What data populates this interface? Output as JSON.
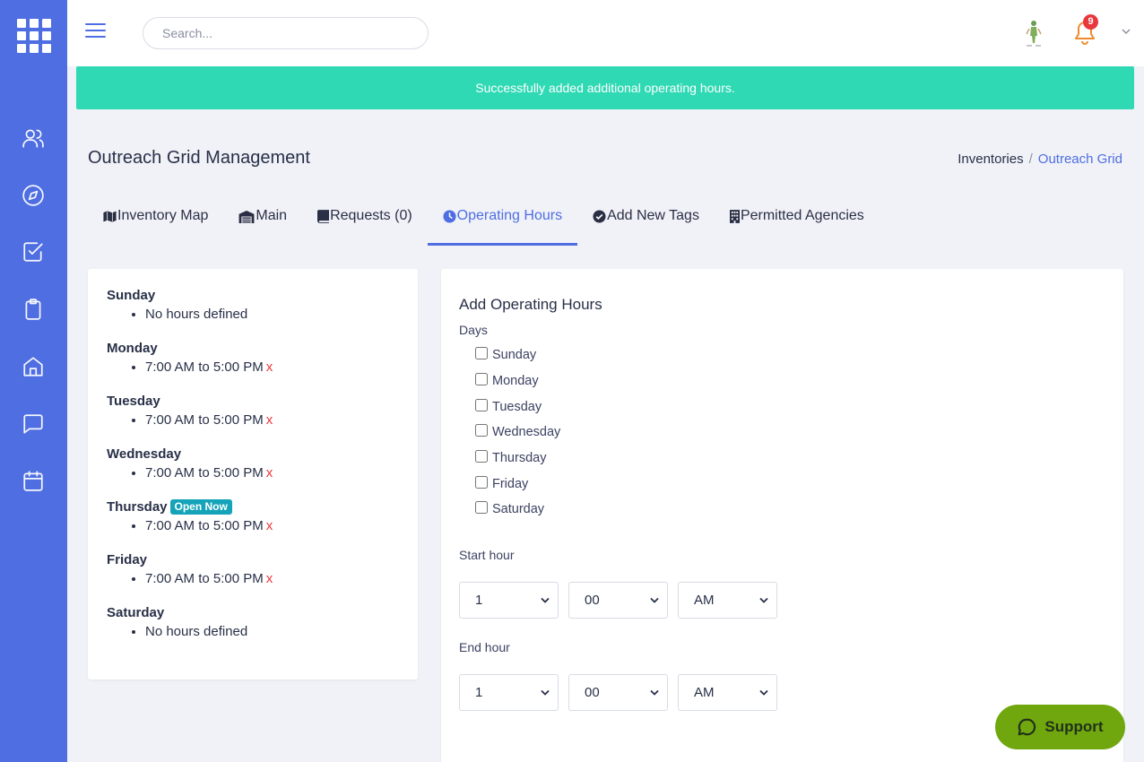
{
  "topbar": {
    "search_placeholder": "Search...",
    "notification_count": "9"
  },
  "alert": {
    "message": "Successfully added additional operating hours."
  },
  "header": {
    "title": "Outreach Grid Management",
    "breadcrumb": [
      {
        "label": "Inventories"
      },
      {
        "label": "Outreach Grid"
      }
    ],
    "breadcrumb_separator": "/"
  },
  "tabs": [
    {
      "label": "Inventory Map",
      "icon": "map-icon"
    },
    {
      "label": "Main",
      "icon": "warehouse-icon"
    },
    {
      "label": "Requests (0)",
      "icon": "book-icon"
    },
    {
      "label": "Operating Hours",
      "icon": "clock-icon",
      "active": true
    },
    {
      "label": "Add New Tags",
      "icon": "check-circle-icon"
    },
    {
      "label": "Permitted Agencies",
      "icon": "building-icon"
    }
  ],
  "schedule": [
    {
      "day": "Sunday",
      "hours": "No hours defined"
    },
    {
      "day": "Monday",
      "hours": "7:00 AM to 5:00 PM"
    },
    {
      "day": "Tuesday",
      "hours": "7:00 AM to 5:00 PM"
    },
    {
      "day": "Wednesday",
      "hours": "7:00 AM to 5:00 PM"
    },
    {
      "day": "Thursday",
      "hours": "7:00 AM to 5:00 PM",
      "badge": "Open Now"
    },
    {
      "day": "Friday",
      "hours": "7:00 AM to 5:00 PM"
    },
    {
      "day": "Saturday",
      "hours": "No hours defined"
    }
  ],
  "remove_label": "x",
  "form": {
    "title": "Add Operating Hours",
    "days_label": "Days",
    "days": [
      "Sunday",
      "Monday",
      "Tuesday",
      "Wednesday",
      "Thursday",
      "Friday",
      "Saturday"
    ],
    "start_label": "Start hour",
    "end_label": "End hour",
    "start": {
      "hour": "1",
      "minute": "00",
      "period": "AM"
    },
    "end": {
      "hour": "1",
      "minute": "00",
      "period": "AM"
    }
  },
  "support_label": "Support",
  "colors": {
    "primary": "#4e6ee2",
    "success": "#2fd9b4",
    "danger": "#e8383d",
    "info": "#14a3b8",
    "support": "#70a70e"
  }
}
